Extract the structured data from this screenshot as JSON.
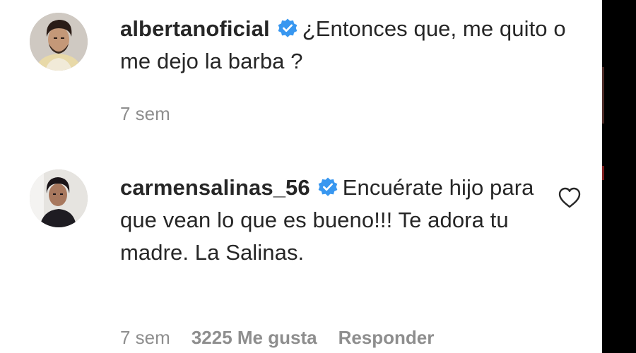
{
  "comments": [
    {
      "username": "albertanoficial",
      "verified": true,
      "text": "¿Entonces que, me quito o me dejo la barba ?",
      "time": "7 sem",
      "avatar_icon": "profile-photo"
    },
    {
      "username": "carmensalinas_56",
      "verified": true,
      "text": "Encuérate hijo para que vean lo que es bueno!!! Te adora tu madre. La Salinas.",
      "time": "7 sem",
      "likes": "3225 Me gusta",
      "reply_label": "Responder",
      "avatar_icon": "profile-photo",
      "like_icon": "heart-outline-icon"
    }
  ],
  "colors": {
    "text": "#262626",
    "meta": "#8e8e8e",
    "verified_badge": "#3897f0"
  }
}
